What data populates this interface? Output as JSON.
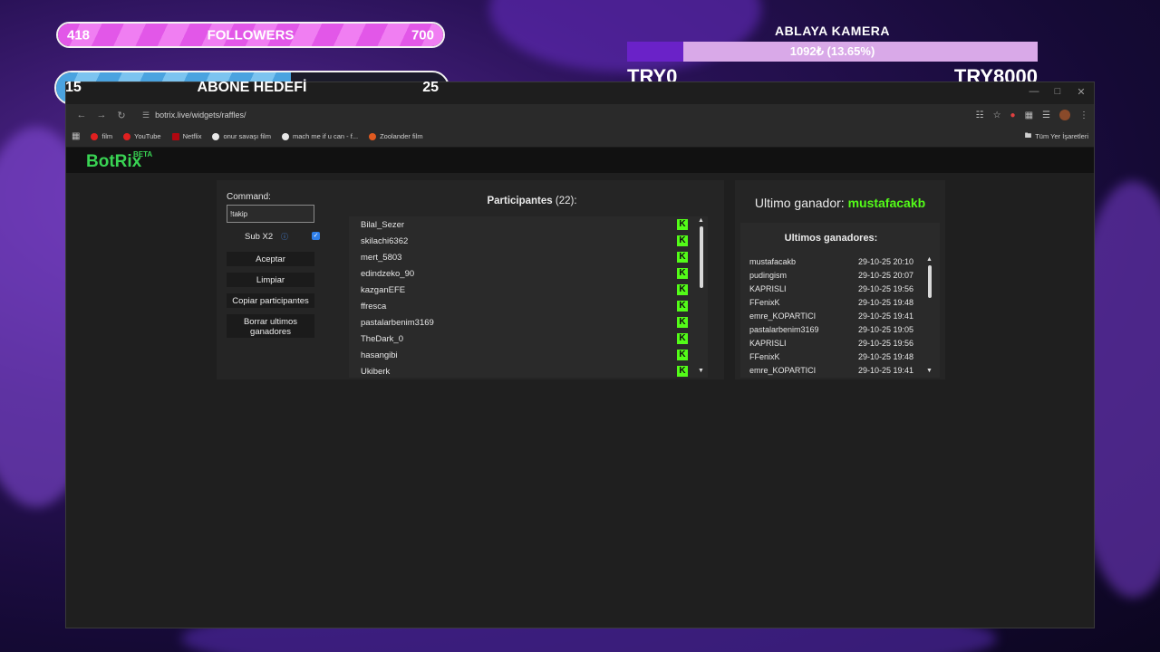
{
  "overlay": {
    "followers": {
      "current": "418",
      "label": "FOLLOWERS",
      "goal": "700",
      "progress_fraction": 1.0
    },
    "abone": {
      "current": "15",
      "label": "ABONE HEDEFİ",
      "goal": "25",
      "progress_fraction": 0.6
    },
    "camera": {
      "title": "ABLAYA KAMERA",
      "progress_text": "1092₺ (13.65%)",
      "min": "TRY0",
      "max": "TRY8000",
      "progress_percent": 13.65
    }
  },
  "browser": {
    "url": "botrix.live/widgets/raffles/",
    "bookmarks": [
      "film",
      "YouTube",
      "Netflix",
      "onur savaşı film",
      "mach me if u can - f...",
      "Zoolander film"
    ],
    "all_bookmarks": "Tüm Yer İşaretleri"
  },
  "app": {
    "logo": "BotRix",
    "logo_badge": "BETA",
    "command_label": "Command:",
    "command_value": "!takip",
    "sub_x2_label": "Sub X2",
    "sub_x2_checked": true,
    "buttons": {
      "accept": "Aceptar",
      "clear": "Limpiar",
      "copy": "Copiar participantes",
      "delete_winners": "Borrar ultimos ganadores"
    },
    "participants_title": "Participantes",
    "participants_count": "(22):",
    "participants": [
      "Bilal_Sezer",
      "skilachi6362",
      "mert_5803",
      "edindzeko_90",
      "kazganEFE",
      "ffresca",
      "pastalarbenim3169",
      "TheDark_0",
      "hasangibi",
      "Ukiberk"
    ],
    "last_winner_label": "Ultimo ganador:",
    "last_winner_name": "mustafacakb",
    "winners_title": "Ultimos ganadores:",
    "winners": [
      {
        "name": "mustafacakb",
        "date": "29-10-25 20:10"
      },
      {
        "name": "pudingism",
        "date": "29-10-25 20:07"
      },
      {
        "name": "KAPRISLI",
        "date": "29-10-25 19:56"
      },
      {
        "name": "FFenixK",
        "date": "29-10-25 19:48"
      },
      {
        "name": "emre_KOPARTICI",
        "date": "29-10-25 19:41"
      },
      {
        "name": "pastalarbenim3169",
        "date": "29-10-25 19:05"
      },
      {
        "name": "KAPRISLI",
        "date": "29-10-25 19:56"
      },
      {
        "name": "FFenixK",
        "date": "29-10-25 19:48"
      },
      {
        "name": "emre_KOPARTICI",
        "date": "29-10-25 19:41"
      }
    ],
    "colors": {
      "accent_green": "#53fc18",
      "logo_green": "#39d353"
    }
  }
}
